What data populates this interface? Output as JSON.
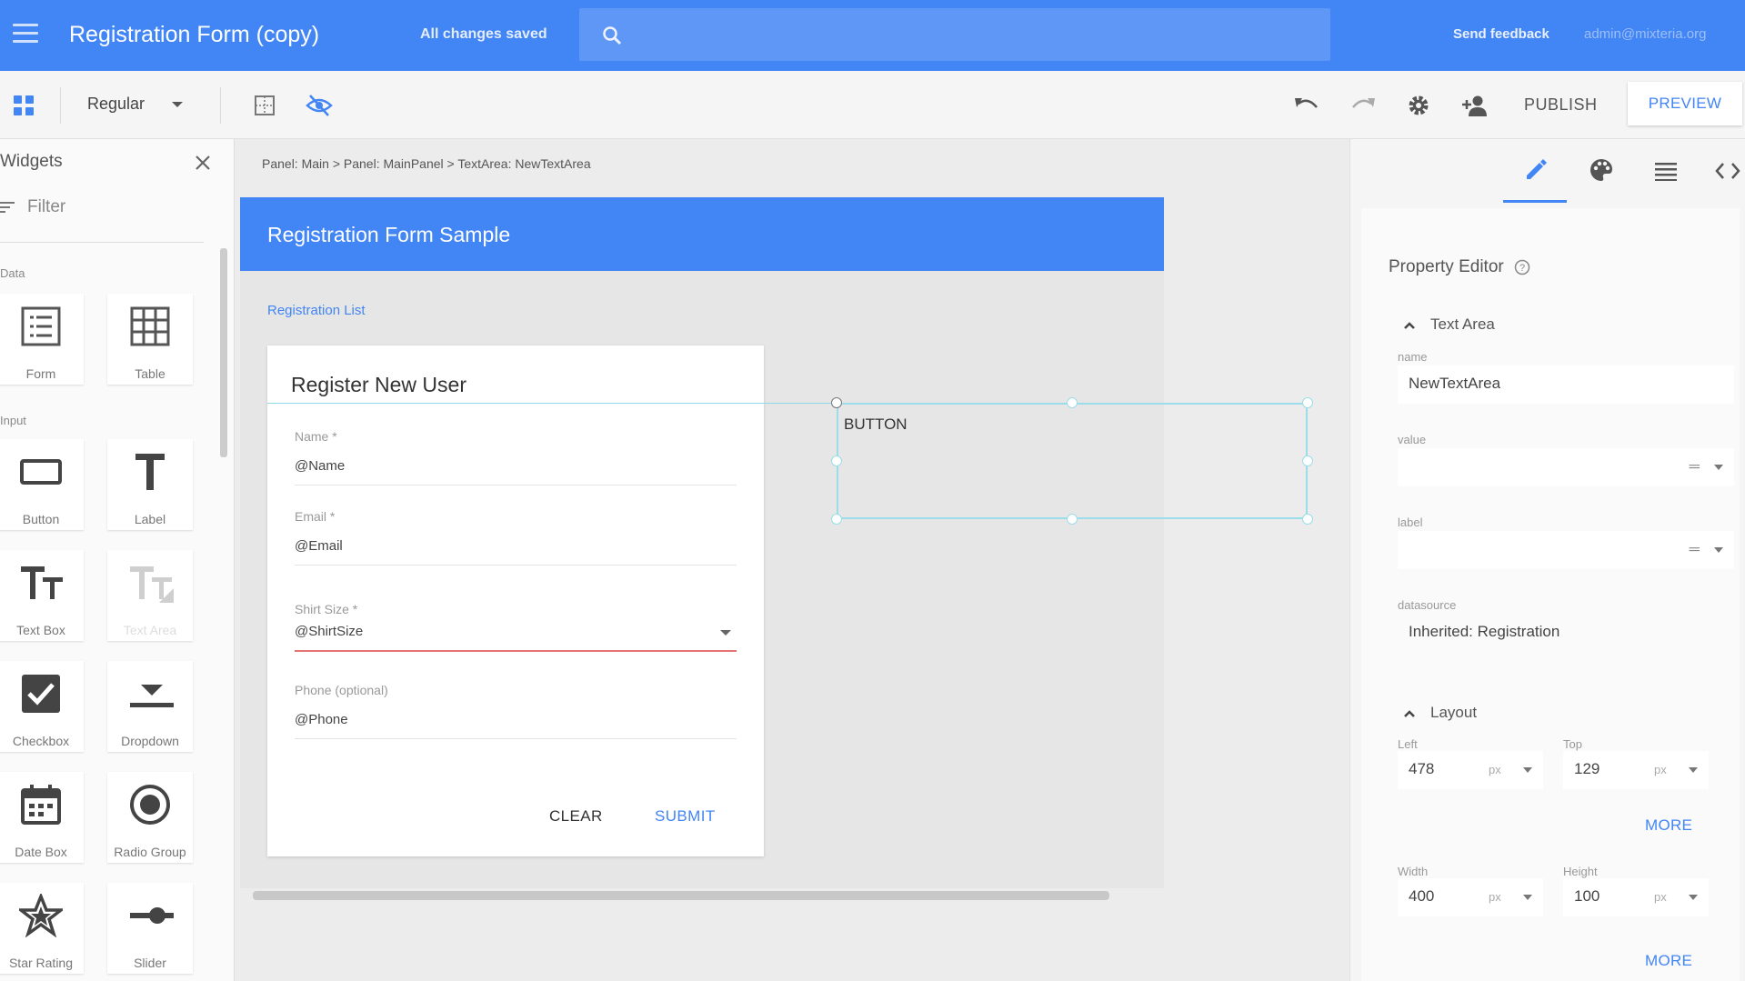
{
  "app": {
    "title": "Registration Form (copy)",
    "save_status": "All changes saved",
    "send_feedback": "Send feedback",
    "user_email": "admin@mixteria.org",
    "accent_color": "#4285f4"
  },
  "toolbar": {
    "style_select": "Regular",
    "publish_label": "PUBLISH",
    "preview_label": "PREVIEW"
  },
  "widgets_panel": {
    "title": "Widgets",
    "filter_placeholder": "Filter",
    "sections": {
      "data": "Data",
      "input": "Input"
    },
    "items": [
      {
        "label": "Form",
        "icon": "form-icon"
      },
      {
        "label": "Table",
        "icon": "table-icon"
      },
      {
        "label": "Button",
        "icon": "button-icon"
      },
      {
        "label": "Label",
        "icon": "label-icon"
      },
      {
        "label": "Text Box",
        "icon": "textbox-icon"
      },
      {
        "label": "Text Area",
        "icon": "textarea-icon"
      },
      {
        "label": "Checkbox",
        "icon": "checkbox-icon"
      },
      {
        "label": "Dropdown",
        "icon": "dropdown-icon"
      },
      {
        "label": "Date Box",
        "icon": "calendar-icon"
      },
      {
        "label": "Radio Group",
        "icon": "radio-icon"
      },
      {
        "label": "Star Rating",
        "icon": "star-icon"
      },
      {
        "label": "Slider",
        "icon": "slider-icon"
      }
    ]
  },
  "canvas": {
    "breadcrumb": "Panel: Main > Panel: MainPanel > TextArea: NewTextArea",
    "banner_title": "Registration Form Sample",
    "registration_list_link": "Registration List",
    "card_title": "Register New User",
    "fields": [
      {
        "label": "Name *",
        "value": "@Name"
      },
      {
        "label": "Email *",
        "value": "@Email"
      },
      {
        "label": "Shirt Size *",
        "value": "@ShirtSize"
      },
      {
        "label": "Phone (optional)",
        "value": "@Phone"
      }
    ],
    "clear_label": "CLEAR",
    "submit_label": "SUBMIT",
    "button_widget_label": "BUTTON"
  },
  "property_editor": {
    "title": "Property Editor",
    "text_area_group": "Text Area",
    "name_label": "name",
    "name_value": "NewTextArea",
    "value_label": "value",
    "label_label": "label",
    "datasource_label": "datasource",
    "datasource_value": "Inherited: Registration",
    "layout_group": "Layout",
    "left_label": "Left",
    "left_value": "478",
    "top_label": "Top",
    "top_value": "129",
    "width_label": "Width",
    "width_value": "400",
    "height_label": "Height",
    "height_value": "100",
    "unit": "px",
    "more_label": "MORE"
  }
}
